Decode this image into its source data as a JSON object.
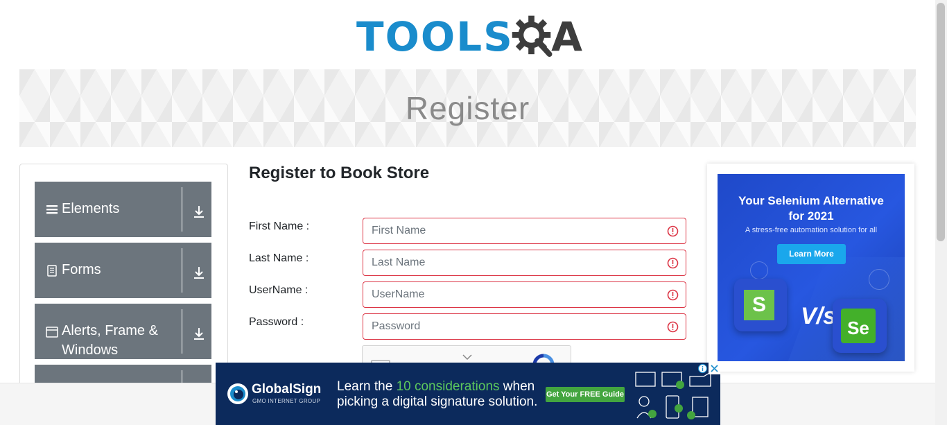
{
  "header": {
    "logo_text_left": "TOOLS",
    "logo_text_right": "A"
  },
  "banner": {
    "title": "Register"
  },
  "sidebar": {
    "groups": [
      {
        "label": "Elements",
        "icon": "hamburger-icon"
      },
      {
        "label": "Forms",
        "icon": "document-icon"
      },
      {
        "label": "Alerts, Frame &",
        "label2": "Windows",
        "icon": "window-icon"
      },
      {
        "label": "",
        "icon": ""
      }
    ]
  },
  "form": {
    "title": "Register to Book Store",
    "fields": [
      {
        "label": "First Name :",
        "placeholder": "First Name",
        "value": ""
      },
      {
        "label": "Last Name :",
        "placeholder": "Last Name",
        "value": ""
      },
      {
        "label": "UserName :",
        "placeholder": "UserName",
        "value": ""
      },
      {
        "label": "Password :",
        "placeholder": "Password",
        "value": ""
      }
    ]
  },
  "ad_right": {
    "headline_line1": "Your Selenium Alternative",
    "headline_line2": "for 2021",
    "subtext": "A stress-free automation solution for all",
    "cta": "Learn More",
    "vs": "V/s",
    "left_logo_letter": "S",
    "right_logo_letters": "Se"
  },
  "ad_bottom": {
    "brand": "GlobalSign",
    "brand_sub": "GMO INTERNET GROUP",
    "msg_part1": "Learn the ",
    "msg_highlight": "10 considerations",
    "msg_part2": " when",
    "msg_line2": "picking a digital signature solution.",
    "cta": "Get Your FREE Guide"
  },
  "colors": {
    "brand_blue": "#1a8ccc",
    "sidebar_gray": "#6c757d",
    "error_red": "#dc3545",
    "ad_blue": "#1f49c9"
  }
}
